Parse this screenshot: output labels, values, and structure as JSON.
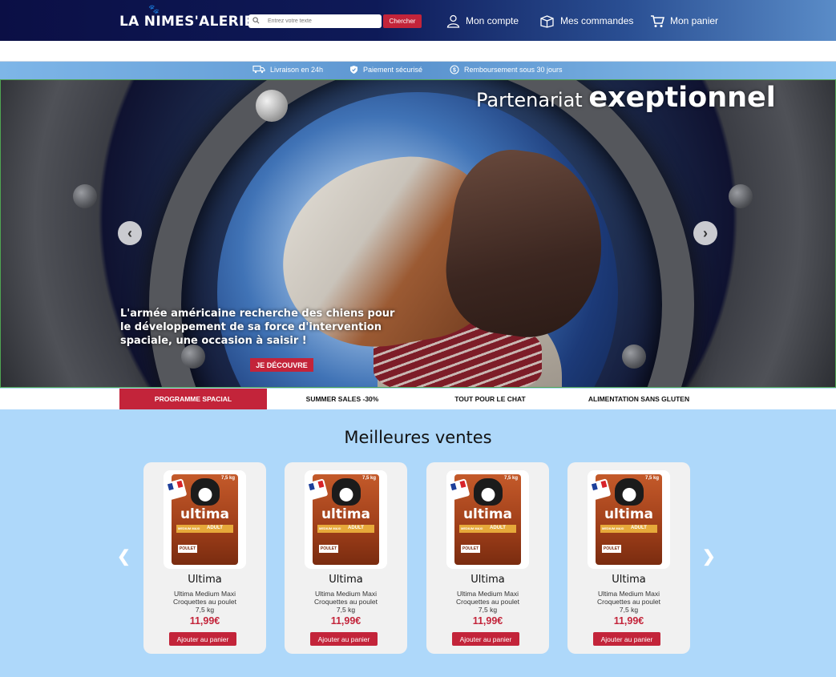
{
  "header": {
    "logo": "LA NIMES'ALERIE",
    "search_placeholder": "Entrez votre texte",
    "search_button": "Chercher",
    "account": "Mon compte",
    "orders": "Mes commandes",
    "cart": "Mon panier"
  },
  "benefits": [
    {
      "label": "Livraison en 24h",
      "icon": "truck-icon"
    },
    {
      "label": "Paiement sécurisé",
      "icon": "shield-icon"
    },
    {
      "label": "Remboursement sous 30 jours",
      "icon": "money-back-icon"
    }
  ],
  "hero": {
    "title_part1": "Partenariat ",
    "title_part2": "exeptionnel",
    "text": "L'armée américaine recherche des chiens pour le développement de sa force d'intervention spaciale, une occasion à saisir !",
    "cta": "JE DÉCOUVRE"
  },
  "categories": [
    {
      "label": "PROGRAMME SPACIAL",
      "active": true
    },
    {
      "label": "SUMMER SALES -30%",
      "active": false
    },
    {
      "label": "TOUT POUR LE CHAT",
      "active": false
    },
    {
      "label": "ALIMENTATION SANS GLUTEN",
      "active": false
    }
  ],
  "best_sellers": {
    "title": "Meilleures ventes",
    "products": [
      {
        "name": "Ultima",
        "line1": "Ultima Medium Maxi",
        "line2": "Croquettes au poulet",
        "line3": "7,5 kg",
        "price": "11,99€",
        "button": "Ajouter au panier"
      },
      {
        "name": "Ultima",
        "line1": "Ultima Medium Maxi",
        "line2": "Croquettes au poulet",
        "line3": "7,5 kg",
        "price": "11,99€",
        "button": "Ajouter au panier"
      },
      {
        "name": "Ultima",
        "line1": "Ultima Medium Maxi",
        "line2": "Croquettes au poulet",
        "line3": "7,5 kg",
        "price": "11,99€",
        "button": "Ajouter au panier"
      },
      {
        "name": "Ultima",
        "line1": "Ultima Medium Maxi",
        "line2": "Croquettes au poulet",
        "line3": "7,5 kg",
        "price": "11,99€",
        "button": "Ajouter au panier"
      }
    ]
  },
  "package": {
    "weight": "7,5 kg",
    "brand": "ultima",
    "size": "MEDIUM MAXI",
    "age": "ADULT",
    "flavor": "POULET"
  },
  "colors": {
    "accent": "#c3243a",
    "header_dark": "#0b0f45",
    "page_bg": "#aed8fa"
  }
}
